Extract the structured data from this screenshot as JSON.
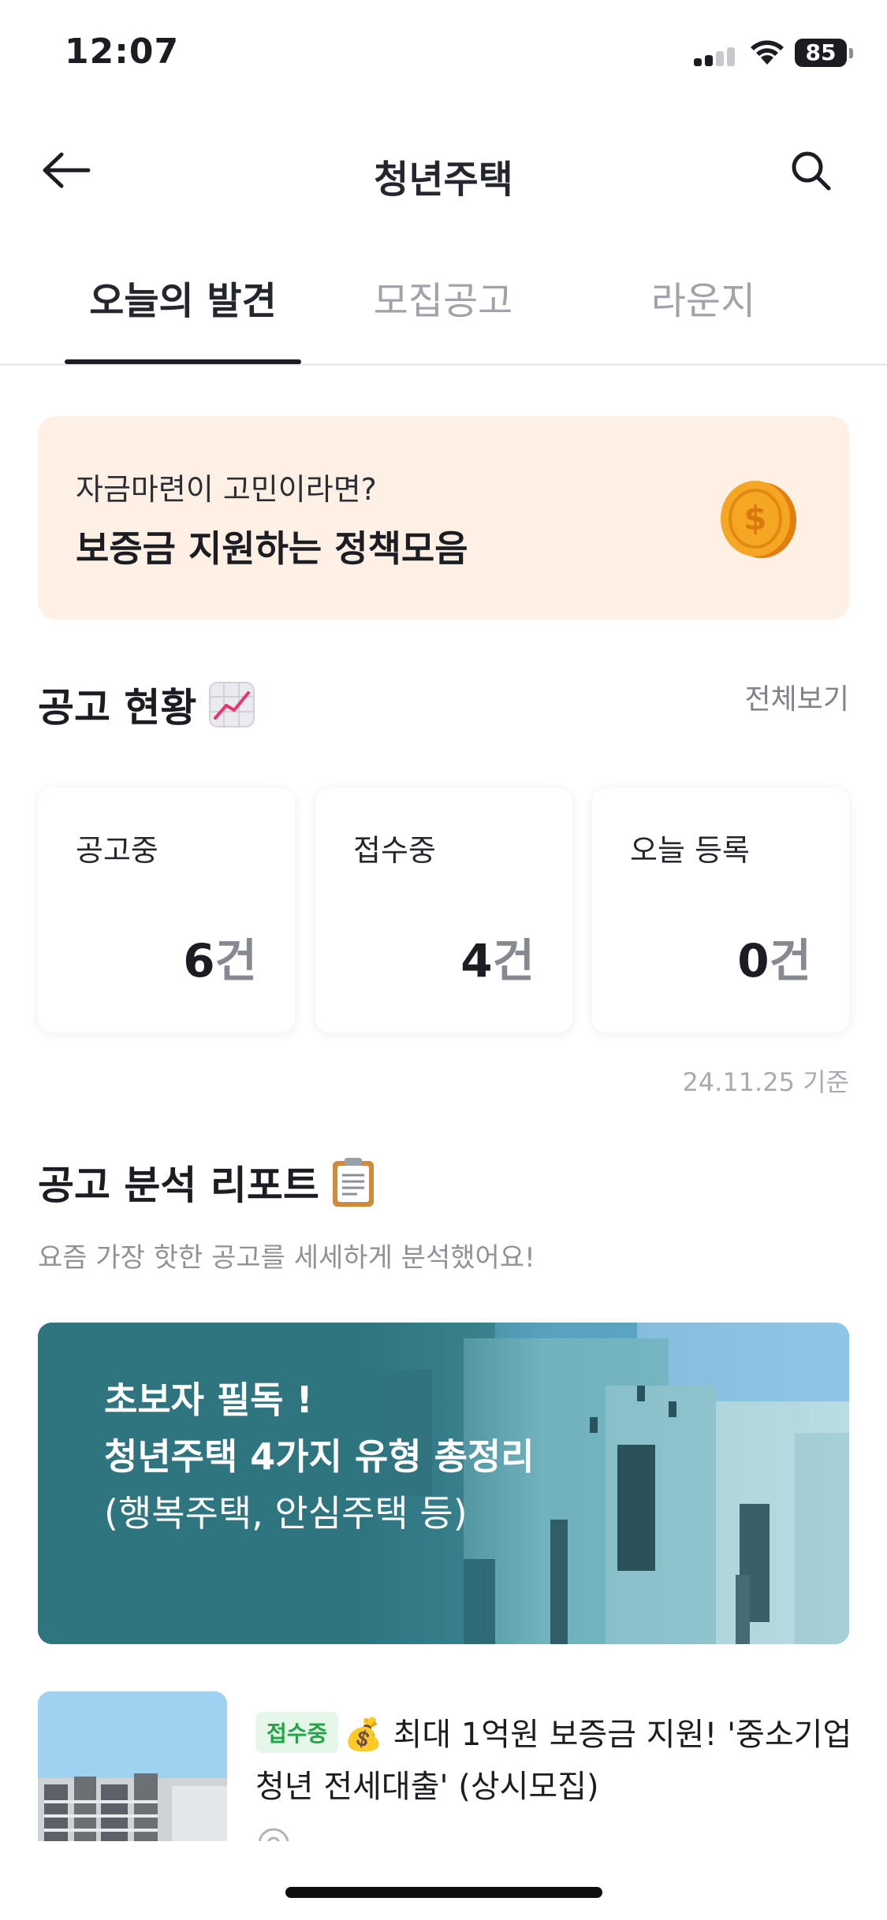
{
  "status_bar": {
    "time": "12:07",
    "battery": "85"
  },
  "nav": {
    "title": "청년주택"
  },
  "tabs": [
    {
      "label": "오늘의 발견",
      "active": true
    },
    {
      "label": "모집공고",
      "active": false
    },
    {
      "label": "라운지",
      "active": false
    }
  ],
  "promo": {
    "subtitle": "자금마련이 고민이라면?",
    "title": "보증금 지원하는 정책모음",
    "icon": "coin-icon"
  },
  "status_section": {
    "title": "공고 현황",
    "icon": "chart-increasing-icon",
    "see_all": "전체보기",
    "as_of": "24.11.25 기준"
  },
  "stats": [
    {
      "label": "공고중",
      "value": "6",
      "unit": "건"
    },
    {
      "label": "접수중",
      "value": "4",
      "unit": "건"
    },
    {
      "label": "오늘 등록",
      "value": "0",
      "unit": "건"
    }
  ],
  "report_section": {
    "title": "공고 분석 리포트",
    "icon": "clipboard-icon",
    "subtitle": "요즘 가장 핫한 공고를 세세하게 분석했어요!"
  },
  "report_banner": {
    "line1": "초보자 필독 !",
    "line2": "청년주택 4가지 유형 총정리",
    "line3": "(행복주택, 안심주택 등)"
  },
  "list_item": {
    "badge": "접수중",
    "title": "💰 최대 1억원 보증금 지원! '중소기업청년 전세대출' (상시모집)"
  },
  "colors": {
    "promo_bg": "#fff0e6",
    "banner_teal": "#2e7580",
    "badge_green": "#22a447"
  }
}
